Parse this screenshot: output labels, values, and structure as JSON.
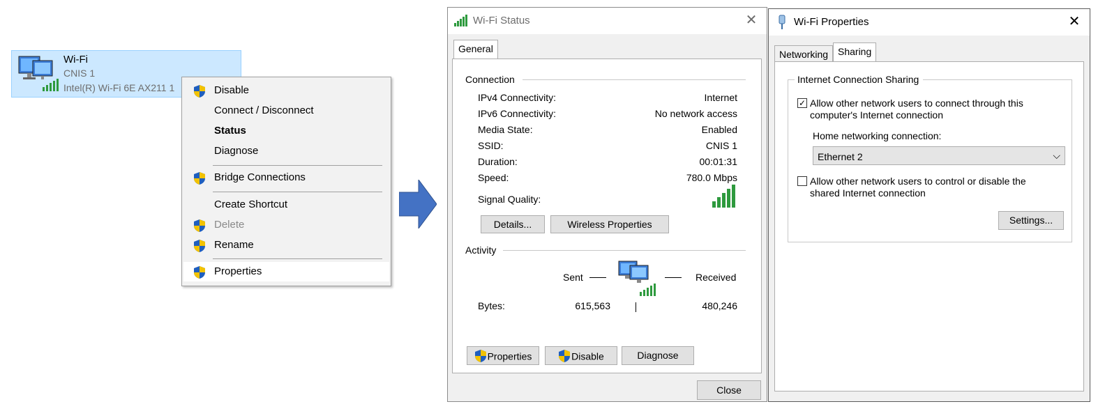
{
  "adapter": {
    "name": "Wi-Fi",
    "ssid": "CNIS 1",
    "description": "Intel(R) Wi-Fi 6E AX211 1"
  },
  "context_menu": {
    "items": [
      {
        "label": "Disable",
        "shield": true
      },
      {
        "label": "Connect / Disconnect",
        "shield": false
      },
      {
        "label": "Status",
        "shield": false,
        "bold": true
      },
      {
        "label": "Diagnose",
        "shield": false
      },
      {
        "label": "Bridge Connections",
        "shield": true
      },
      {
        "label": "Create Shortcut",
        "shield": false
      },
      {
        "label": "Delete",
        "shield": true,
        "disabled": true
      },
      {
        "label": "Rename",
        "shield": true
      },
      {
        "label": "Properties",
        "shield": true,
        "highlighted": true
      }
    ]
  },
  "status_window": {
    "title": "Wi-Fi Status",
    "tab": "General",
    "connection_label": "Connection",
    "rows": [
      {
        "key": "IPv4 Connectivity:",
        "value": "Internet"
      },
      {
        "key": "IPv6 Connectivity:",
        "value": "No network access"
      },
      {
        "key": "Media State:",
        "value": "Enabled"
      },
      {
        "key": "SSID:",
        "value": "CNIS 1"
      },
      {
        "key": "Duration:",
        "value": "00:01:31"
      },
      {
        "key": "Speed:",
        "value": "780.0 Mbps"
      }
    ],
    "signal_label": "Signal Quality:",
    "details_button": "Details...",
    "wireless_button": "Wireless Properties",
    "activity_label": "Activity",
    "sent_label": "Sent",
    "received_label": "Received",
    "bytes_label": "Bytes:",
    "bytes_sent": "615,563",
    "bytes_received": "480,246",
    "properties_button": "Properties",
    "disable_button": "Disable",
    "diagnose_button": "Diagnose",
    "close_button": "Close"
  },
  "properties_window": {
    "title": "Wi-Fi Properties",
    "tabs": [
      "Networking",
      "Sharing"
    ],
    "active_tab": "Sharing",
    "group_label": "Internet Connection Sharing",
    "allow_connect_text": "Allow other network users to connect through this computer's Internet connection",
    "allow_connect_checked": true,
    "home_label": "Home networking connection:",
    "home_value": "Ethernet 2",
    "allow_control_text": "Allow other network users to control or disable the shared Internet connection",
    "allow_control_checked": false,
    "settings_button": "Settings..."
  },
  "colors": {
    "selection_bg": "#cce8ff",
    "arrow": "#4472c4",
    "signal_green": "#2e9a3e",
    "shield_blue": "#1f5fbf",
    "shield_yellow": "#f2c200"
  }
}
